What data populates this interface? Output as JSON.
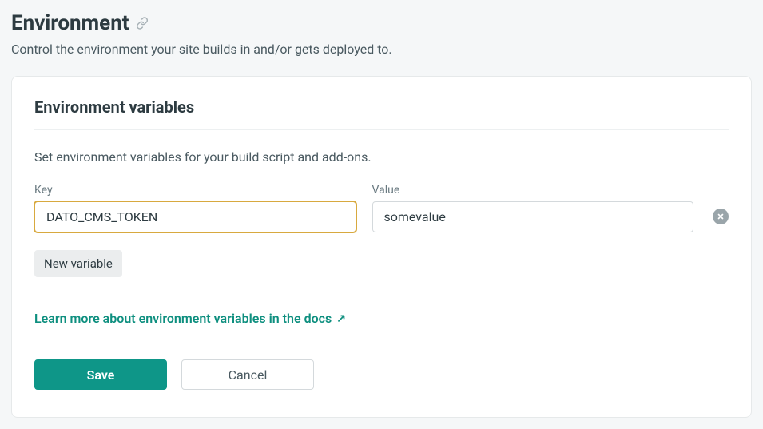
{
  "section": {
    "title": "Environment",
    "subtitle": "Control the environment your site builds in and/or gets deployed to."
  },
  "card": {
    "title": "Environment variables",
    "description": "Set environment variables for your build script and add-ons.",
    "keyLabel": "Key",
    "valueLabel": "Value",
    "rows": [
      {
        "key": "DATO_CMS_TOKEN",
        "value": "somevalue"
      }
    ],
    "newVariableLabel": "New variable",
    "docsLinkLabel": "Learn more about environment variables in the docs",
    "saveLabel": "Save",
    "cancelLabel": "Cancel"
  }
}
